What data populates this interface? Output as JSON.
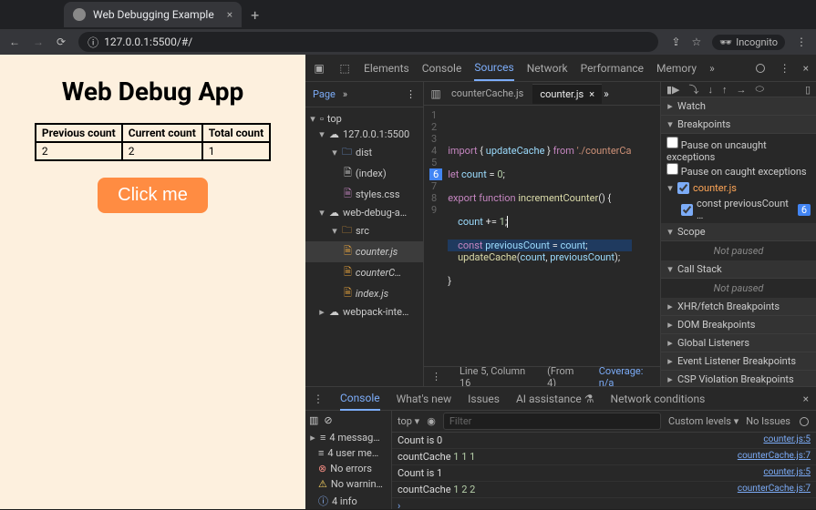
{
  "browser": {
    "tab_title": "Web Debugging Example",
    "url": "127.0.0.1:5500/#/",
    "incognito_label": "Incognito"
  },
  "webapp": {
    "title": "Web Debug App",
    "cols": [
      "Previous count",
      "Current count",
      "Total count"
    ],
    "vals": [
      "2",
      "2",
      "1"
    ],
    "button": "Click me"
  },
  "devtools": {
    "tabs": [
      "Elements",
      "Console",
      "Sources",
      "Network",
      "Performance",
      "Memory"
    ],
    "active_tab": "Sources",
    "subtab": "Page",
    "tree": {
      "top": "top",
      "host": "127.0.0.1:5500",
      "dist": "dist",
      "index": "(index)",
      "styles": "styles.css",
      "webdebug": "web-debug-a…",
      "src": "src",
      "counter": "counter.js",
      "counterC": "counterC…",
      "indexjs": "index.js",
      "webpack": "webpack-inte…"
    },
    "open_files": [
      "counterCache.js",
      "counter.js"
    ],
    "active_file": "counter.js",
    "code": {
      "l1": "",
      "l2": "import { updateCache } from './counterCa",
      "l3": "let count = 0;",
      "l4": "export function incrementCounter() {",
      "l5": "    count += 1;",
      "l6": "    const previousCount = count;",
      "l7": "    updateCache(count, previousCount);",
      "l8": "}",
      "l9": ""
    },
    "status": {
      "pos": "Line 5, Column 16",
      "from": "(From 4)",
      "cov": "Coverage: n/a"
    },
    "right": {
      "watch": "Watch",
      "breakpoints": "Breakpoints",
      "pause_uncaught": "Pause on uncaught exceptions",
      "pause_caught": "Pause on caught exceptions",
      "bp_file": "counter.js",
      "bp_line": "const previousCount …",
      "bp_linenum": "6",
      "scope": "Scope",
      "not_paused": "Not paused",
      "callstack": "Call Stack",
      "xhr": "XHR/fetch Breakpoints",
      "dom": "DOM Breakpoints",
      "global": "Global Listeners",
      "event": "Event Listener Breakpoints",
      "csp": "CSP Violation Breakpoints"
    }
  },
  "console": {
    "tabs": [
      "Console",
      "What's new",
      "Issues",
      "AI assistance",
      "Network conditions"
    ],
    "filter_placeholder": "Filter",
    "context": "top",
    "levels": "Custom levels",
    "no_issues": "No Issues",
    "side": {
      "messages": "4 messag…",
      "user": "4 user me…",
      "errors": "No errors",
      "warnings": "No warnin…",
      "info": "4 info"
    },
    "logs": [
      {
        "msg": "Count is 0",
        "src": "counter.js:5"
      },
      {
        "msg": "countCache",
        "arr": "1 1 1",
        "src": "counterCache.js:7"
      },
      {
        "msg": "Count is 1",
        "src": "counter.js:5"
      },
      {
        "msg": "countCache",
        "arr": "1 2 2",
        "src": "counterCache.js:7"
      }
    ]
  }
}
